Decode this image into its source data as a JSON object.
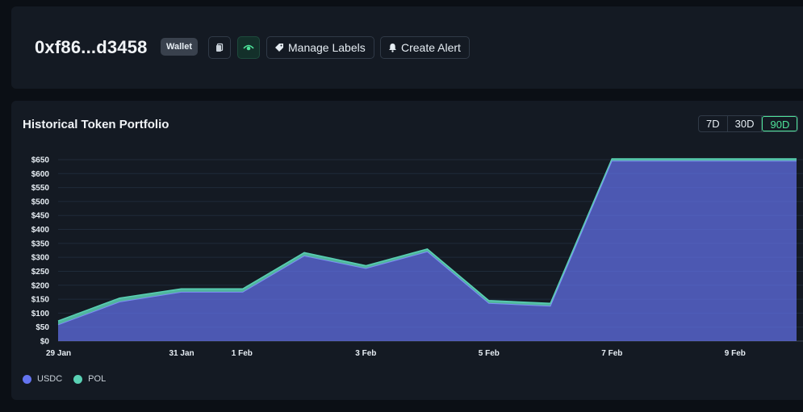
{
  "header": {
    "address": "0xf86...d3458",
    "badge": "Wallet",
    "copy_icon": "copy-icon",
    "watch_icon": "eye-icon",
    "manage_labels": "Manage Labels",
    "create_alert": "Create Alert"
  },
  "portfolio": {
    "title": "Historical Token Portfolio",
    "ranges": [
      "7D",
      "30D",
      "90D"
    ],
    "active_range": "90D"
  },
  "colors": {
    "usdc": "#6474f0",
    "pol": "#5ad1b4",
    "accent": "#4ee39a"
  },
  "chart_data": {
    "type": "area",
    "title": "Historical Token Portfolio",
    "x_labels": [
      "29 Jan",
      "31 Jan",
      "1 Feb",
      "3 Feb",
      "5 Feb",
      "7 Feb",
      "9 Feb"
    ],
    "y_ticks": [
      "$0",
      "$50",
      "$100",
      "$150",
      "$200",
      "$250",
      "$300",
      "$350",
      "$400",
      "$450",
      "$500",
      "$550",
      "$600",
      "$650"
    ],
    "ylim": [
      0,
      650
    ],
    "stacked": true,
    "x": [
      "29 Jan",
      "30 Jan",
      "31 Jan",
      "1 Feb",
      "2 Feb",
      "3 Feb",
      "4 Feb",
      "5 Feb",
      "6 Feb",
      "7 Feb",
      "8 Feb",
      "9 Feb",
      "10 Feb"
    ],
    "series": [
      {
        "name": "USDC",
        "values": [
          58,
          140,
          175,
          175,
          305,
          260,
          320,
          135,
          125,
          645,
          645,
          645,
          645
        ]
      },
      {
        "name": "POL",
        "values": [
          14,
          14,
          12,
          12,
          12,
          10,
          10,
          10,
          10,
          8,
          8,
          8,
          8
        ]
      }
    ],
    "grid": true,
    "legend": "bottom-left"
  }
}
